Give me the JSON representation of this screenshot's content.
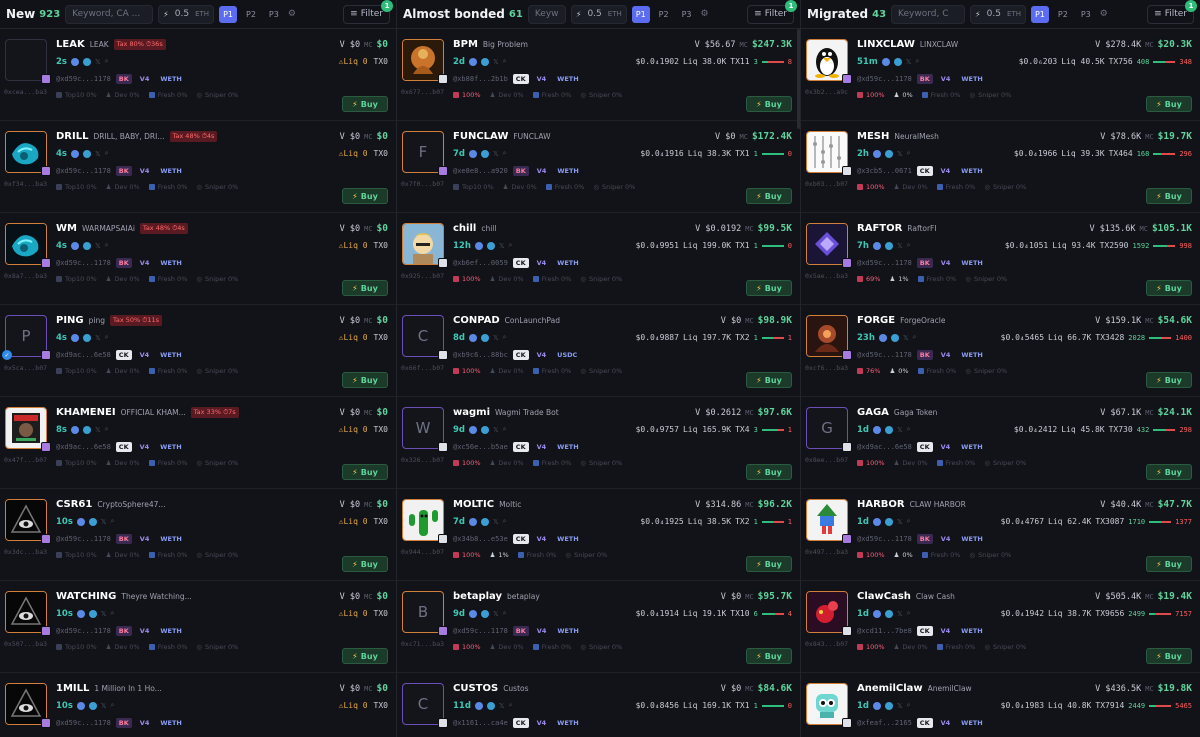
{
  "columns": [
    {
      "key": "new",
      "title": "New",
      "count": "923",
      "search_placeholder": "Keyword, CA ...",
      "amount": "0.5",
      "unit": "ETH",
      "presets": [
        "P1",
        "P2",
        "P3"
      ],
      "filter_label": "Filter",
      "filter_badge": "1",
      "cards": [
        {
          "symbol": "LEAK",
          "name": "LEAK",
          "tax": "Tax 80% ⏱36s",
          "v": "V $0",
          "mc": "$0",
          "age": "2s",
          "liq": "⚠Liq 0",
          "tx": "TX0",
          "dev": "@xd59c...1178",
          "tag": "BK",
          "dex": "V4",
          "quote": "WETH",
          "addr": "0xcea...ba3",
          "top10": "Top10 0%",
          "devp": "Dev 0%",
          "fresh": "Fresh 0%",
          "sniper": "Sniper 0%",
          "buy": "Buy",
          "avatar": "blank"
        },
        {
          "symbol": "DRILL",
          "name": "DRILL, BABY, DRI...",
          "tax": "Tax 48% ⏱4s",
          "v": "V $0",
          "mc": "$0",
          "age": "4s",
          "liq": "⚠Liq 0",
          "tx": "TX0",
          "dev": "@xd59c...1178",
          "tag": "BK",
          "dex": "V4",
          "quote": "WETH",
          "addr": "0xf34...ba3",
          "top10": "Top10 0%",
          "devp": "Dev 0%",
          "fresh": "Fresh 0%",
          "sniper": "Sniper 0%",
          "buy": "Buy",
          "avatar": "drill"
        },
        {
          "symbol": "WM",
          "name": "WARMAPSAIAi",
          "tax": "Tax 48% ⏱4s",
          "v": "V $0",
          "mc": "$0",
          "age": "4s",
          "liq": "⚠Liq 0",
          "tx": "TX0",
          "dev": "@xd59c...1178",
          "tag": "BK",
          "dex": "V4",
          "quote": "WETH",
          "addr": "0x8a7...ba3",
          "top10": "Top10 0%",
          "devp": "Dev 0%",
          "fresh": "Fresh 0%",
          "sniper": "Sniper 0%",
          "buy": "Buy",
          "avatar": "drill"
        },
        {
          "symbol": "PING",
          "name": "ping",
          "tax": "Tax 50% ⏱11s",
          "v": "V $0",
          "mc": "$0",
          "age": "4s",
          "liq": "⚠Liq 0",
          "tx": "TX0",
          "dev": "@xd9ac...6e58",
          "tag": "CK",
          "dex": "V4",
          "quote": "WETH",
          "addr": "0x5ca...b07",
          "top10": "Top10 0%",
          "devp": "Dev 0%",
          "fresh": "Fresh 0%",
          "sniper": "Sniper 0%",
          "buy": "Buy",
          "avatar": "P"
        },
        {
          "symbol": "KHAMENEI",
          "name": "OFFICIAL KHAM...",
          "tax": "Tax 33% ⏱7s",
          "v": "V $0",
          "mc": "$0",
          "age": "8s",
          "liq": "⚠Liq 0",
          "tx": "TX0",
          "dev": "@xd9ac...6e58",
          "tag": "CK",
          "dex": "V4",
          "quote": "WETH",
          "addr": "0x47f...b07",
          "top10": "Top10 0%",
          "devp": "Dev 0%",
          "fresh": "Fresh 0%",
          "sniper": "Sniper 0%",
          "buy": "Buy",
          "avatar": "poster"
        },
        {
          "symbol": "CSR61",
          "name": "CryptoSphere47...",
          "tax": "",
          "v": "V $0",
          "mc": "$0",
          "age": "10s",
          "liq": "⚠Liq 0",
          "tx": "TX0",
          "dev": "@xd59c...1178",
          "tag": "BK",
          "dex": "V4",
          "quote": "WETH",
          "addr": "0x3dc...ba3",
          "top10": "Top10 0%",
          "devp": "Dev 0%",
          "fresh": "Fresh 0%",
          "sniper": "Sniper 0%",
          "buy": "Buy",
          "avatar": "eye"
        },
        {
          "symbol": "WATCHING",
          "name": "Theyre Watching...",
          "tax": "",
          "v": "V $0",
          "mc": "$0",
          "age": "10s",
          "liq": "⚠Liq 0",
          "tx": "TX0",
          "dev": "@xd59c...1178",
          "tag": "BK",
          "dex": "V4",
          "quote": "WETH",
          "addr": "0x507...ba3",
          "top10": "Top10 0%",
          "devp": "Dev 0%",
          "fresh": "Fresh 0%",
          "sniper": "Sniper 0%",
          "buy": "Buy",
          "avatar": "eye"
        },
        {
          "symbol": "1MILL",
          "name": "1 Million In 1 Ho...",
          "tax": "",
          "v": "V $0",
          "mc": "$0",
          "age": "10s",
          "liq": "⚠Liq 0",
          "tx": "TX0",
          "dev": "@xd59c...1178",
          "tag": "BK",
          "dex": "V4",
          "quote": "WETH",
          "addr": "",
          "top10": "",
          "devp": "",
          "fresh": "",
          "sniper": "",
          "buy": "",
          "avatar": "eye"
        }
      ]
    },
    {
      "key": "bonded",
      "title": "Almost bonded",
      "count": "61",
      "search_placeholder": "Keyw",
      "amount": "0.5",
      "unit": "ETH",
      "presets": [
        "P1",
        "P2",
        "P3"
      ],
      "filter_label": "Filter",
      "filter_badge": "1",
      "cards": [
        {
          "symbol": "BPM",
          "name": "Big Problem",
          "v": "V $56.67",
          "mc": "$247.3K",
          "age": "2d",
          "price": "$0.0₄1902",
          "liqv": "Liq 38.0K",
          "tx": "TX11",
          "b": "3",
          "s": "8",
          "sellfrac": 0.7,
          "dev": "@xb88f...2b1b",
          "tag": "CK",
          "dex": "V4",
          "quote": "WETH",
          "addr": "0x677...b07",
          "top10": "100%",
          "devp": "Dev 0%",
          "fresh": "Fresh 0%",
          "sniper": "Sniper 0%",
          "buy": "Buy",
          "avatar": "buddha"
        },
        {
          "symbol": "FUNCLAW",
          "name": "FUNCLAW",
          "v": "V $0",
          "mc": "$172.4K",
          "age": "7d",
          "price": "$0.0₄1916",
          "liqv": "Liq 38.3K",
          "tx": "TX1",
          "b": "1",
          "s": "0",
          "sellfrac": 0,
          "dev": "@xe8e8...a920",
          "tag": "BK",
          "dex": "V4",
          "quote": "WETH",
          "addr": "0x7f0...b07",
          "top10": "Top10 0%",
          "devp": "Dev 0%",
          "fresh": "Fresh 0%",
          "sniper": "Sniper 0%",
          "buy": "Buy",
          "avatar": "F"
        },
        {
          "symbol": "chill",
          "name": "chill",
          "v": "V $0.0192",
          "mc": "$99.5K",
          "age": "12h",
          "price": "$0.0₄9951",
          "liqv": "Liq 199.0K",
          "tx": "TX1",
          "b": "1",
          "s": "0",
          "sellfrac": 0,
          "dev": "@xb6ef...0059",
          "tag": "CK",
          "dex": "V4",
          "quote": "WETH",
          "addr": "0x925...b07",
          "top10": "100%",
          "devp": "Dev 0%",
          "fresh": "Fresh 0%",
          "sniper": "Sniper 0%",
          "buy": "Buy",
          "avatar": "chill"
        },
        {
          "symbol": "CONPAD",
          "name": "ConLaunchPad",
          "v": "V $0",
          "mc": "$98.9K",
          "age": "8d",
          "price": "$0.0₄9887",
          "liqv": "Liq 197.7K",
          "tx": "TX2",
          "b": "1",
          "s": "1",
          "sellfrac": 0.5,
          "dev": "@xb9c6...88bc",
          "tag": "CK",
          "dex": "V4",
          "quote": "USDC",
          "addr": "0x66f...b07",
          "top10": "100%",
          "devp": "Dev 0%",
          "fresh": "Fresh 0%",
          "sniper": "Sniper 0%",
          "buy": "Buy",
          "avatar": "C"
        },
        {
          "symbol": "wagmi",
          "name": "Wagmi Trade Bot",
          "v": "V $0.2612",
          "mc": "$97.6K",
          "age": "9d",
          "price": "$0.0₄9757",
          "liqv": "Liq 165.9K",
          "tx": "TX4",
          "b": "3",
          "s": "1",
          "sellfrac": 0.25,
          "dev": "@xc56e...b5ae",
          "tag": "CK",
          "dex": "V4",
          "quote": "WETH",
          "addr": "0x326...b07",
          "top10": "100%",
          "devp": "Dev 0%",
          "fresh": "Fresh 0%",
          "sniper": "Sniper 0%",
          "buy": "Buy",
          "avatar": "W"
        },
        {
          "symbol": "MOLTIC",
          "name": "Moltic",
          "v": "V $314.86",
          "mc": "$96.2K",
          "age": "7d",
          "price": "$0.0₄1925",
          "liqv": "Liq 38.5K",
          "tx": "TX2",
          "b": "1",
          "s": "1",
          "sellfrac": 0.5,
          "dev": "@x34b8...e53e",
          "tag": "CK",
          "dex": "V4",
          "quote": "WETH",
          "addr": "0x944...b07",
          "top10": "100%",
          "devp": "1%",
          "fresh": "Fresh 0%",
          "sniper": "Sniper 0%",
          "buy": "Buy",
          "avatar": "cactus"
        },
        {
          "symbol": "betaplay",
          "name": "betaplay",
          "v": "V $0",
          "mc": "$95.7K",
          "age": "9d",
          "price": "$0.0₄1914",
          "liqv": "Liq 19.1K",
          "tx": "TX10",
          "b": "6",
          "s": "4",
          "sellfrac": 0.4,
          "dev": "@xd59c...1178",
          "tag": "BK",
          "dex": "V4",
          "quote": "WETH",
          "addr": "0xc71...ba3",
          "top10": "100%",
          "devp": "Dev 0%",
          "fresh": "Fresh 0%",
          "sniper": "Sniper 0%",
          "buy": "Buy",
          "avatar": "B"
        },
        {
          "symbol": "CUSTOS",
          "name": "Custos",
          "v": "V $0",
          "mc": "$84.6K",
          "age": "11d",
          "price": "$0.0₄8456",
          "liqv": "Liq 169.1K",
          "tx": "TX1",
          "b": "1",
          "s": "0",
          "sellfrac": 0,
          "dev": "@x1161...ca4e",
          "tag": "CK",
          "dex": "V4",
          "quote": "WETH",
          "addr": "",
          "top10": "",
          "devp": "",
          "fresh": "",
          "sniper": "",
          "buy": "",
          "avatar": "C"
        }
      ]
    },
    {
      "key": "migrated",
      "title": "Migrated",
      "count": "43",
      "search_placeholder": "Keyword, C",
      "amount": "0.5",
      "unit": "ETH",
      "presets": [
        "P1",
        "P2",
        "P3"
      ],
      "filter_label": "Filter",
      "filter_badge": "1",
      "cards": [
        {
          "symbol": "LINXCLAW",
          "name": "LINXCLAW",
          "v": "V $278.4K",
          "mc": "$20.3K",
          "age": "51m",
          "price": "$0.0₆203",
          "liqv": "Liq 40.5K",
          "tx": "TX756",
          "b": "408",
          "s": "348",
          "sellfrac": 0.46,
          "dev": "@xd59c...1178",
          "tag": "BK",
          "dex": "V4",
          "quote": "WETH",
          "addr": "0x3b2...a9c",
          "top10": "100%",
          "devp": "0%",
          "fresh": "Fresh 0%",
          "sniper": "Sniper 0%",
          "buy": "Buy",
          "avatar": "tux"
        },
        {
          "symbol": "MESH",
          "name": "NeuralMesh",
          "v": "V $78.6K",
          "mc": "$19.7K",
          "age": "2h",
          "price": "$0.0₄1966",
          "liqv": "Liq 39.3K",
          "tx": "TX464",
          "b": "168",
          "s": "296",
          "sellfrac": 0.64,
          "dev": "@x3cb5...0671",
          "tag": "CK",
          "dex": "V4",
          "quote": "WETH",
          "addr": "0xb03...b07",
          "top10": "100%",
          "devp": "Dev 0%",
          "fresh": "Fresh 0%",
          "sniper": "Sniper 0%",
          "buy": "Buy",
          "avatar": "mesh"
        },
        {
          "symbol": "RAFTOR",
          "name": "RaftorFI",
          "v": "V $135.6K",
          "mc": "$105.1K",
          "age": "7h",
          "price": "$0.0₄1051",
          "liqv": "Liq 93.4K",
          "tx": "TX2590",
          "b": "1592",
          "s": "998",
          "sellfrac": 0.38,
          "dev": "@xd59c...1178",
          "tag": "BK",
          "dex": "V4",
          "quote": "WETH",
          "addr": "0x5ae...ba3",
          "top10": "69%",
          "devp": "1%",
          "fresh": "Fresh 0%",
          "sniper": "Sniper 0%",
          "buy": "Buy",
          "avatar": "raftor"
        },
        {
          "symbol": "FORGE",
          "name": "ForgeOracle",
          "v": "V $159.1K",
          "mc": "$54.6K",
          "age": "23h",
          "price": "$0.0₄5465",
          "liqv": "Liq 66.7K",
          "tx": "TX3428",
          "b": "2028",
          "s": "1400",
          "sellfrac": 0.41,
          "dev": "@xd59c...1178",
          "tag": "BK",
          "dex": "V4",
          "quote": "WETH",
          "addr": "0xcf6...ba3",
          "top10": "76%",
          "devp": "0%",
          "fresh": "Fresh 0%",
          "sniper": "Sniper 0%",
          "buy": "Buy",
          "avatar": "forge"
        },
        {
          "symbol": "GAGA",
          "name": "Gaga Token",
          "v": "V $67.1K",
          "mc": "$24.1K",
          "age": "1d",
          "price": "$0.0₄2412",
          "liqv": "Liq 45.8K",
          "tx": "TX730",
          "b": "432",
          "s": "298",
          "sellfrac": 0.41,
          "dev": "@xd9ac...6e58",
          "tag": "CK",
          "dex": "V4",
          "quote": "WETH",
          "addr": "0x8ee...b07",
          "top10": "100%",
          "devp": "Dev 0%",
          "fresh": "Fresh 0%",
          "sniper": "Sniper 0%",
          "buy": "Buy",
          "avatar": "G"
        },
        {
          "symbol": "HARBOR",
          "name": "CLAW HARBOR",
          "v": "V $40.4K",
          "mc": "$47.7K",
          "age": "1d",
          "price": "$0.0₄4767",
          "liqv": "Liq 62.4K",
          "tx": "TX3087",
          "b": "1710",
          "s": "1377",
          "sellfrac": 0.45,
          "dev": "@xd59c...1178",
          "tag": "BK",
          "dex": "V4",
          "quote": "WETH",
          "addr": "0x497...ba3",
          "top10": "100%",
          "devp": "0%",
          "fresh": "Fresh 0%",
          "sniper": "Sniper 0%",
          "buy": "Buy",
          "avatar": "harbor"
        },
        {
          "symbol": "ClawCash",
          "name": "Claw Cash",
          "v": "V $505.4K",
          "mc": "$19.4K",
          "age": "1d",
          "price": "$0.0₄1942",
          "liqv": "Liq 38.7K",
          "tx": "TX9656",
          "b": "2499",
          "s": "7157",
          "sellfrac": 0.74,
          "dev": "@xcd11...7be8",
          "tag": "CK",
          "dex": "V4",
          "quote": "WETH",
          "addr": "0x843...b07",
          "top10": "100%",
          "devp": "Dev 0%",
          "fresh": "Fresh 0%",
          "sniper": "Sniper 0%",
          "buy": "Buy",
          "avatar": "clawcash"
        },
        {
          "symbol": "AnemilClaw",
          "name": "AnemilClaw",
          "v": "V $436.5K",
          "mc": "$19.8K",
          "age": "1d",
          "price": "$0.0₄1983",
          "liqv": "Liq 40.8K",
          "tx": "TX7914",
          "b": "2449",
          "s": "5465",
          "sellfrac": 0.69,
          "dev": "@xfeaf...2165",
          "tag": "CK",
          "dex": "V4",
          "quote": "WETH",
          "addr": "",
          "top10": "",
          "devp": "",
          "fresh": "",
          "sniper": "",
          "buy": "",
          "avatar": "robot"
        }
      ]
    }
  ],
  "labels": {
    "volume_prefix": "V",
    "mc_label": "MC",
    "top10_placeholder": "Top10 0%"
  },
  "colors": {
    "accent": "#5b6cf0",
    "green": "#5ed39a",
    "red": "#ff5d5d",
    "warning": "#e3a94c"
  }
}
